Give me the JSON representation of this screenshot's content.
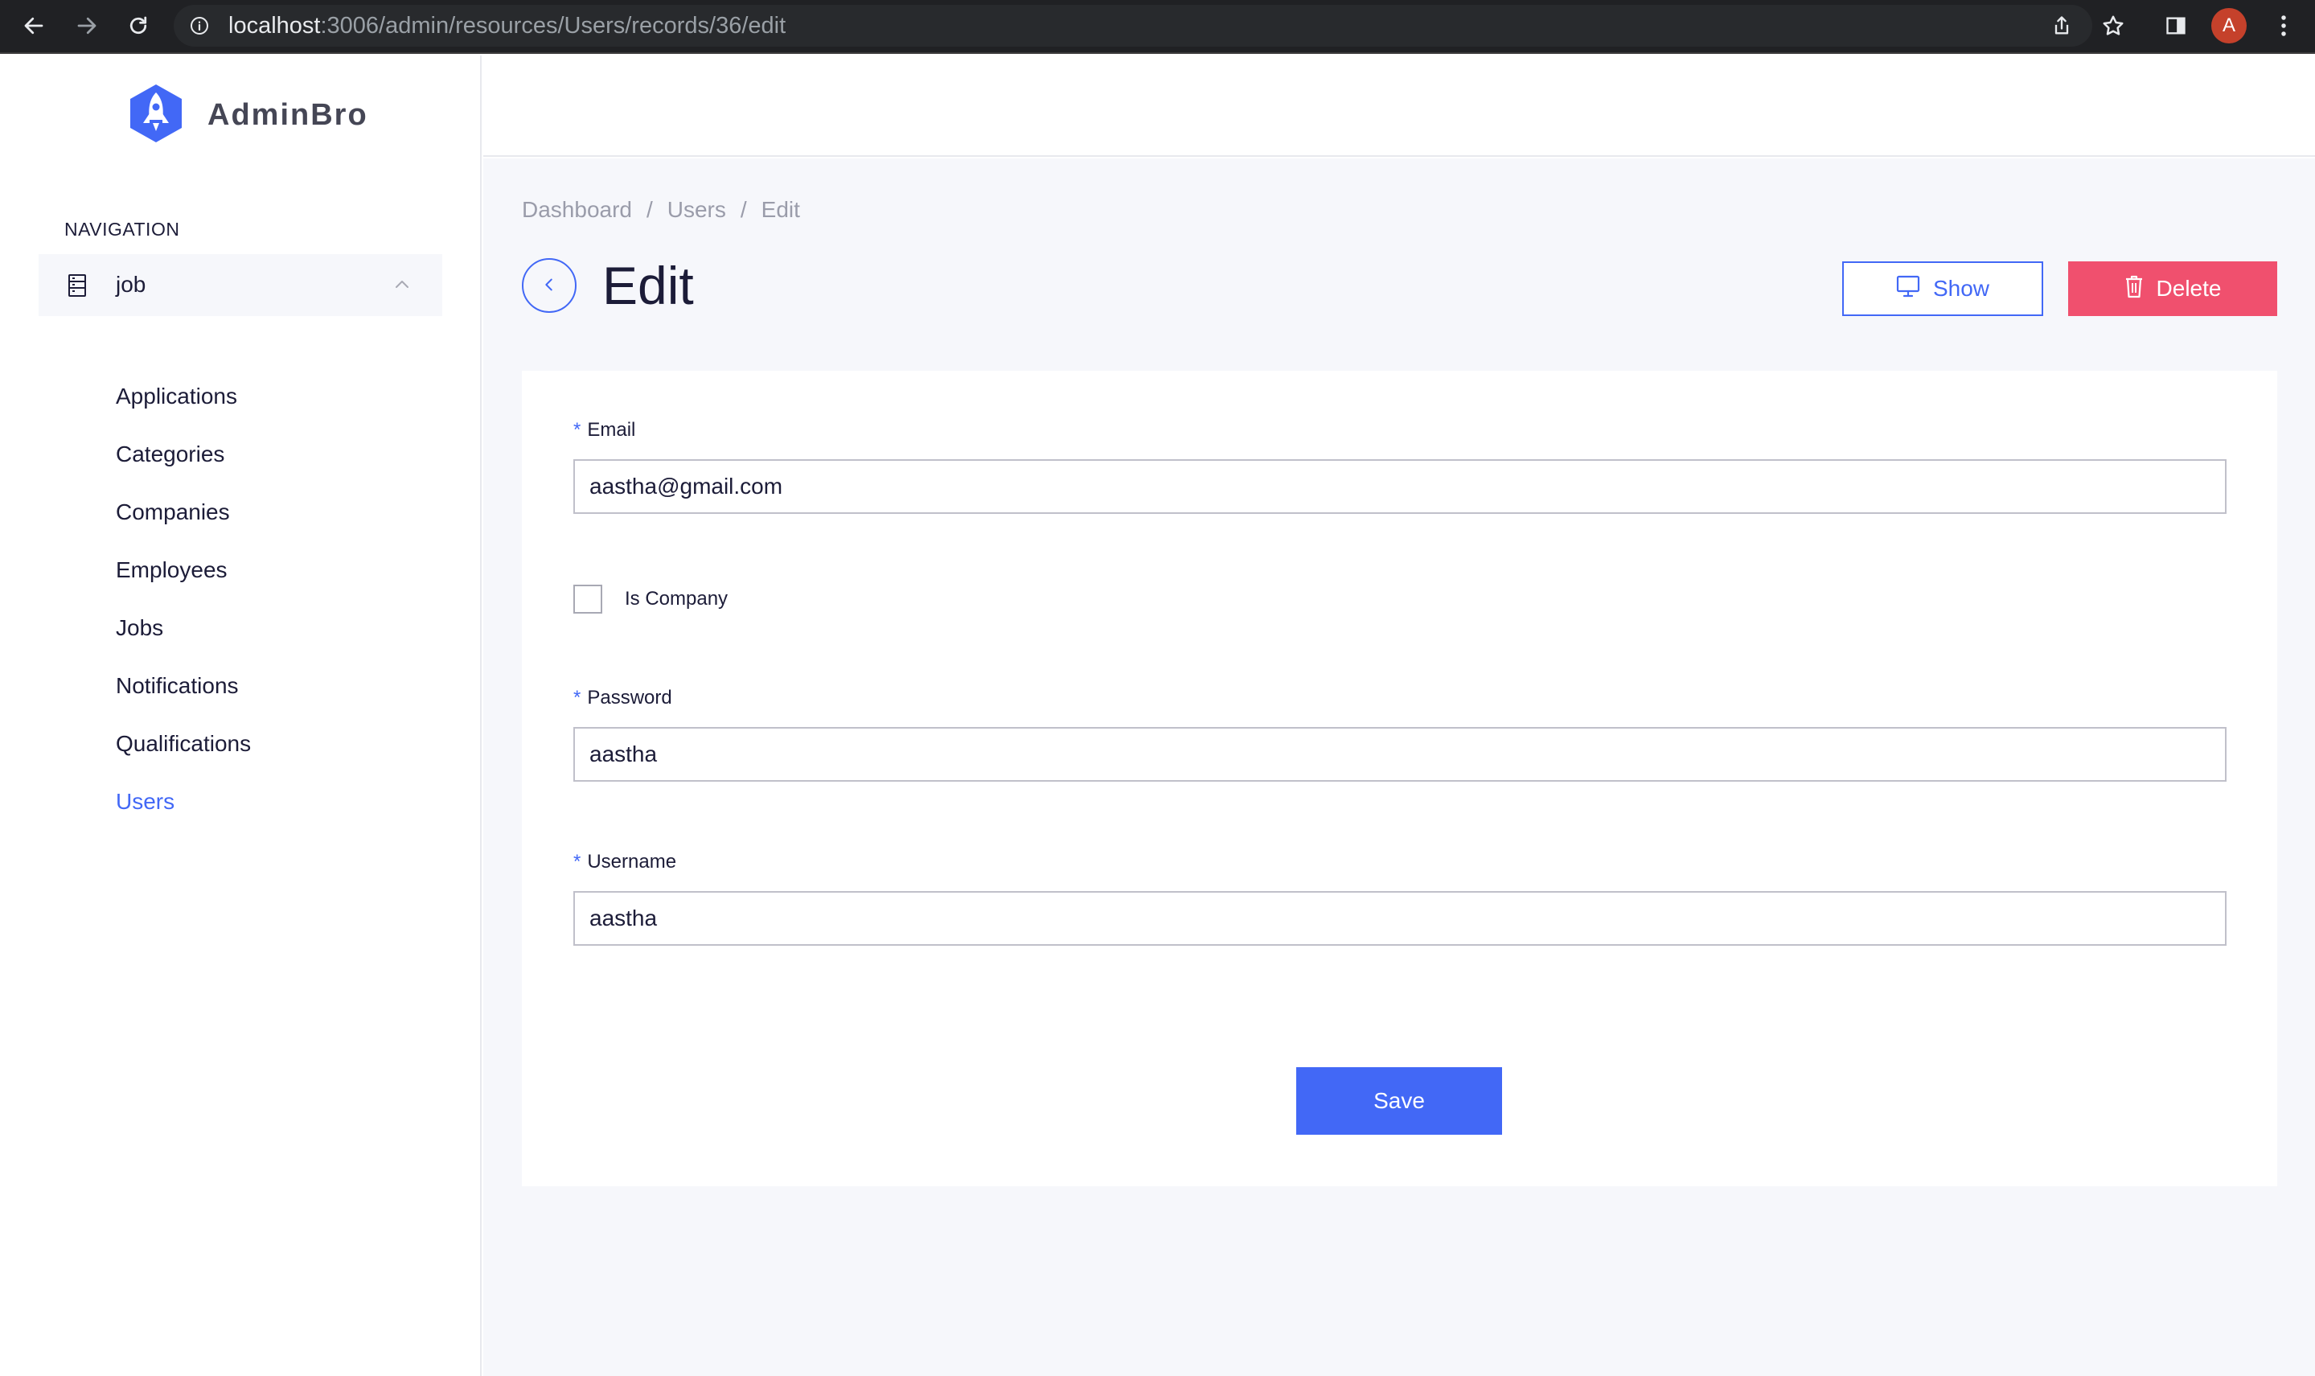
{
  "browser": {
    "url_host": "localhost",
    "url_path": ":3006/admin/resources/Users/records/36/edit",
    "avatar_letter": "A"
  },
  "sidebar": {
    "logo_text": "AdminBro",
    "nav_heading": "NAVIGATION",
    "group_label": "job",
    "items": [
      {
        "label": "Applications",
        "active": false
      },
      {
        "label": "Categories",
        "active": false
      },
      {
        "label": "Companies",
        "active": false
      },
      {
        "label": "Employees",
        "active": false
      },
      {
        "label": "Jobs",
        "active": false
      },
      {
        "label": "Notifications",
        "active": false
      },
      {
        "label": "Qualifications",
        "active": false
      },
      {
        "label": "Users",
        "active": true
      }
    ]
  },
  "breadcrumb": {
    "items": [
      "Dashboard",
      "Users",
      "Edit"
    ],
    "separator": "/"
  },
  "header": {
    "title": "Edit",
    "show_label": "Show",
    "delete_label": "Delete"
  },
  "form": {
    "required_mark": "*",
    "email": {
      "label": "Email",
      "value": "aastha@gmail.com"
    },
    "is_company": {
      "label": "Is Company",
      "checked": false
    },
    "password": {
      "label": "Password",
      "value": "aastha"
    },
    "username": {
      "label": "Username",
      "value": "aastha"
    },
    "save_label": "Save"
  },
  "colors": {
    "accent": "#4268f6",
    "danger": "#f0506e",
    "background": "#f6f7fb"
  },
  "icons": {
    "back": "arrow-left-icon",
    "forward": "arrow-right-icon",
    "reload": "reload-icon",
    "info": "info-icon",
    "share": "share-icon",
    "bookmark": "star-icon",
    "sidepanel": "side-panel-icon",
    "menu": "kebab-menu-icon",
    "logo": "rocket-icon",
    "database": "database-icon",
    "collapse": "chevron-up-icon",
    "show": "monitor-icon",
    "delete": "trash-icon"
  }
}
